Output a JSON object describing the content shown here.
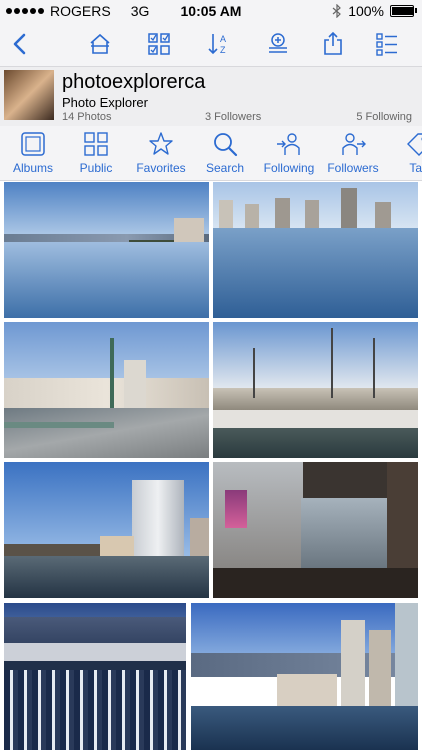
{
  "status": {
    "carrier": "ROGERS",
    "network": "3G",
    "time": "10:05 AM",
    "battery": "100%",
    "battery_level": 1.0
  },
  "toolbar": {
    "icons": [
      "back-icon",
      "home-icon",
      "checklist-grid-icon",
      "sort-az-icon",
      "add-stack-icon",
      "share-icon",
      "list-icon"
    ]
  },
  "profile": {
    "username": "photoexplorerca",
    "display_name": "Photo Explorer",
    "photos": "14 Photos",
    "followers": "3 Followers",
    "following": "5 Following"
  },
  "tabs": [
    {
      "label": "Albums",
      "icon": "albums-icon"
    },
    {
      "label": "Public",
      "icon": "grid-icon"
    },
    {
      "label": "Favorites",
      "icon": "star-icon"
    },
    {
      "label": "Search",
      "icon": "search-icon"
    },
    {
      "label": "Following",
      "icon": "following-icon"
    },
    {
      "label": "Followers",
      "icon": "followers-icon"
    },
    {
      "label": "Tag",
      "icon": "tag-icon"
    }
  ],
  "colors": {
    "accent": "#2c6bd1",
    "bar_bg": "#f4f4f6"
  }
}
